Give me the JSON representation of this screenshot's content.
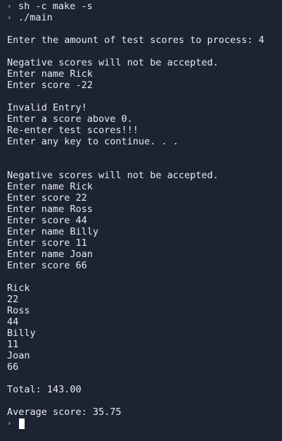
{
  "terminal": {
    "prompt_symbol": "›",
    "commands": [
      "sh -c make -s",
      "./main"
    ],
    "output": [
      "",
      "Enter the amount of test scores to process: 4",
      "",
      "Negative scores will not be accepted.",
      "Enter name Rick",
      "Enter score -22",
      "",
      "Invalid Entry!",
      "Enter a score above 0.",
      "Re-enter test scores!!!",
      "Enter any key to continue. . .",
      "",
      "",
      "Negative scores will not be accepted.",
      "Enter name Rick",
      "Enter score 22",
      "Enter name Ross",
      "Enter score 44",
      "Enter name Billy",
      "Enter score 11",
      "Enter name Joan",
      "Enter score 66",
      "",
      "Rick",
      "22",
      "Ross",
      "44",
      "Billy",
      "11",
      "Joan",
      "66",
      "",
      "Total: 143.00",
      "",
      "Average score: 35.75"
    ]
  }
}
